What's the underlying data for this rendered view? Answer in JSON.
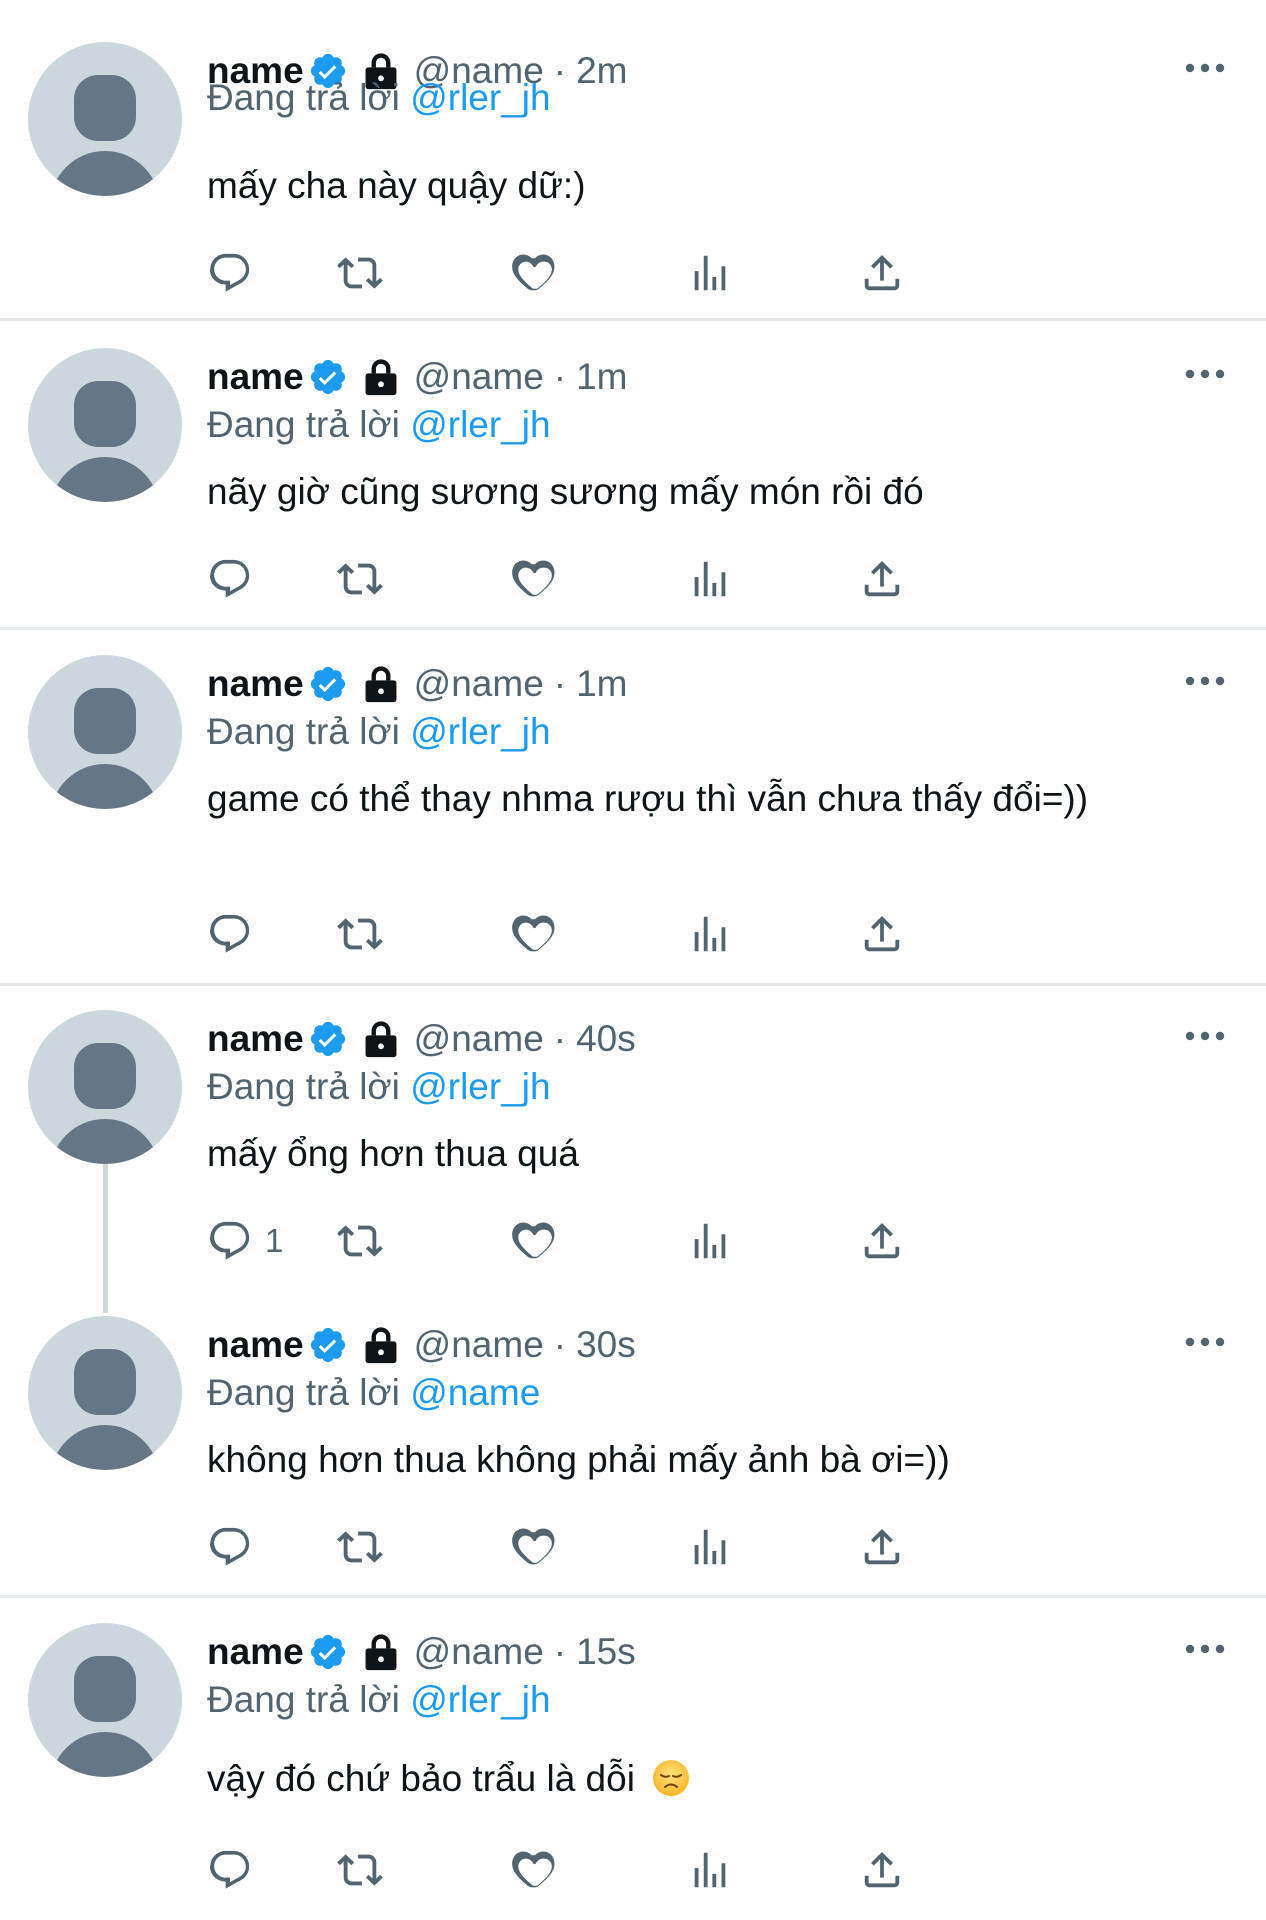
{
  "tweets": [
    {
      "name": "name",
      "handle": "@name",
      "sep": "·",
      "time": "2m",
      "reply_prefix": "Đang trả lời",
      "reply_to": "@rler_jh",
      "text": "mấy cha này quậy dữ:)",
      "reply_count": ""
    },
    {
      "name": "name",
      "handle": "@name",
      "sep": "·",
      "time": "1m",
      "reply_prefix": "Đang trả lời",
      "reply_to": "@rler_jh",
      "text": "nãy giờ cũng sương sương mấy món rồi đó",
      "reply_count": ""
    },
    {
      "name": "name",
      "handle": "@name",
      "sep": "·",
      "time": "1m",
      "reply_prefix": "Đang trả lời",
      "reply_to": "@rler_jh",
      "text": "game có thể thay nhma rượu thì vẫn chưa thấy đổi=))",
      "reply_count": ""
    },
    {
      "name": "name",
      "handle": "@name",
      "sep": "·",
      "time": "40s",
      "reply_prefix": "Đang trả lời",
      "reply_to": "@rler_jh",
      "text": "mấy ổng hơn thua quá",
      "reply_count": "1"
    },
    {
      "name": "name",
      "handle": "@name",
      "sep": "·",
      "time": "30s",
      "reply_prefix": "Đang trả lời",
      "reply_to": "@name",
      "text": "không hơn thua không phải mấy ảnh bà ơi=))",
      "reply_count": ""
    },
    {
      "name": "name",
      "handle": "@name",
      "sep": "·",
      "time": "15s",
      "reply_prefix": "Đang trả lời",
      "reply_to": "@rler_jh",
      "text": "vậy đó chứ bảo trẩu là dỗi",
      "emoji": "disappointed-face-emoji",
      "reply_count": ""
    }
  ],
  "icons": {
    "verified": "verified-badge-icon",
    "lock": "lock-icon",
    "more": "more-options-icon",
    "reply": "reply-icon",
    "retweet": "retweet-icon",
    "like": "like-icon",
    "views": "views-icon",
    "share": "share-icon"
  },
  "colors": {
    "accent": "#1d9bf0",
    "secondary_text": "#536471",
    "avatar_bg": "#ccd6dd",
    "avatar_fg": "#657786"
  }
}
